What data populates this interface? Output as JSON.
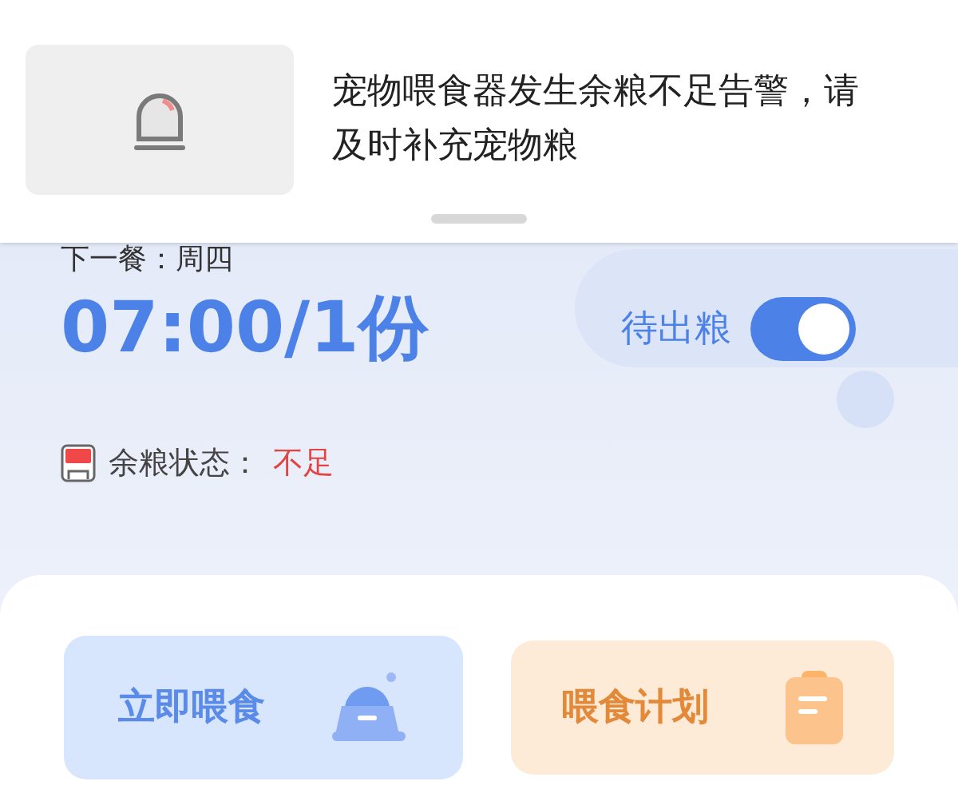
{
  "notification": {
    "message": "宠物喂食器发生余粮不足告警，请及时补充宠物粮"
  },
  "next_meal": {
    "label": "下一餐：周四",
    "time": "07:00/1份"
  },
  "toggle": {
    "label": "待出粮",
    "on": true
  },
  "food_status": {
    "label": "余粮状态：",
    "value": "不足"
  },
  "actions": [
    {
      "kind": "feed",
      "label": "立即喂食"
    },
    {
      "kind": "plan",
      "label": "喂食计划"
    }
  ]
}
